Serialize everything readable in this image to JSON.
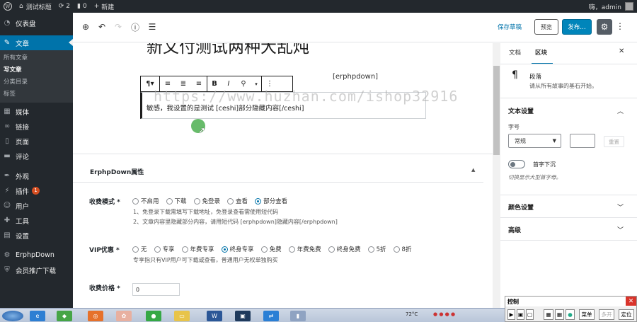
{
  "adminbar": {
    "site_name": "测试标题",
    "updates_count": "2",
    "comments_count": "0",
    "new_label": "新建",
    "greeting": "嗨，admin"
  },
  "sidebar": {
    "items": [
      {
        "label": "仪表盘",
        "icon": "dashboard-icon"
      },
      {
        "label": "文章",
        "icon": "pin-icon"
      },
      {
        "label": "媒体",
        "icon": "media-icon"
      },
      {
        "label": "链接",
        "icon": "link-icon"
      },
      {
        "label": "页面",
        "icon": "page-icon"
      },
      {
        "label": "评论",
        "icon": "comment-icon"
      },
      {
        "label": "外观",
        "icon": "appearance-icon"
      },
      {
        "label": "插件",
        "icon": "plugin-icon",
        "badge": "1"
      },
      {
        "label": "用户",
        "icon": "user-icon"
      },
      {
        "label": "工具",
        "icon": "tools-icon"
      },
      {
        "label": "设置",
        "icon": "settings-icon"
      },
      {
        "label": "ErphpDown",
        "icon": "erphpdown-icon"
      },
      {
        "label": "会员推广下载",
        "icon": "shield-icon"
      }
    ],
    "submenu": [
      "所有文章",
      "写文章",
      "分类目录",
      "标签"
    ]
  },
  "toolbar": {
    "save_draft": "保存草稿",
    "preview": "预览",
    "publish": "发布…"
  },
  "editor": {
    "title": "新文付测试两种大乱炖",
    "behind_paragraph": "[erphpdown]",
    "block_text": "敏感，我设置的是测试 [ceshi]部分隐藏内容[/ceshi]",
    "watermark": "https://www.huzhan.com/ishop32916"
  },
  "metabox": {
    "title": "ErphpDown属性",
    "fee_mode_label": "收费模式 *",
    "fee_mode_options": [
      "不启用",
      "下载",
      "免登录",
      "查看",
      "部分查看"
    ],
    "fee_mode_selected": "部分查看",
    "fee_mode_hint1": "1、免登录下载需填写下载地址，免登录查看需使用短代码",
    "fee_mode_hint2": "2、文章内容里隐藏部分内容，请用短代码 [erphpdown]隐藏内容[/erphpdown]",
    "vip_label": "VIP优惠 *",
    "vip_options": [
      "无",
      "专享",
      "年费专享",
      "终身专享",
      "免费",
      "年费免费",
      "终身免费",
      "5折",
      "8折"
    ],
    "vip_selected": "终身专享",
    "vip_hint": "专享指只有VIP用户可下载或查看，普通用户无权单独购买",
    "price_label": "收费价格 *",
    "price_value": "0"
  },
  "rpanel": {
    "tab_doc": "文档",
    "tab_block": "区块",
    "block_name": "段落",
    "block_desc": "请从所有故事的基石开始。",
    "text_settings": "文本设置",
    "font_size_label": "字号",
    "font_size_value": "常规",
    "reset_label": "重置",
    "drop_cap_label": "首字下沉",
    "drop_cap_hint": "切换显示大型首字母。",
    "color_settings": "颜色设置",
    "advanced": "高级"
  },
  "control_window": {
    "title": "控制",
    "menu_label": "菜单",
    "multi_label": "多开",
    "locate_label": "定位"
  },
  "taskbar": {
    "temperature": "72°C"
  },
  "colors": {
    "accent": "#0073aa",
    "publish": "#0085ba",
    "sidebar_bg": "#23282d"
  }
}
